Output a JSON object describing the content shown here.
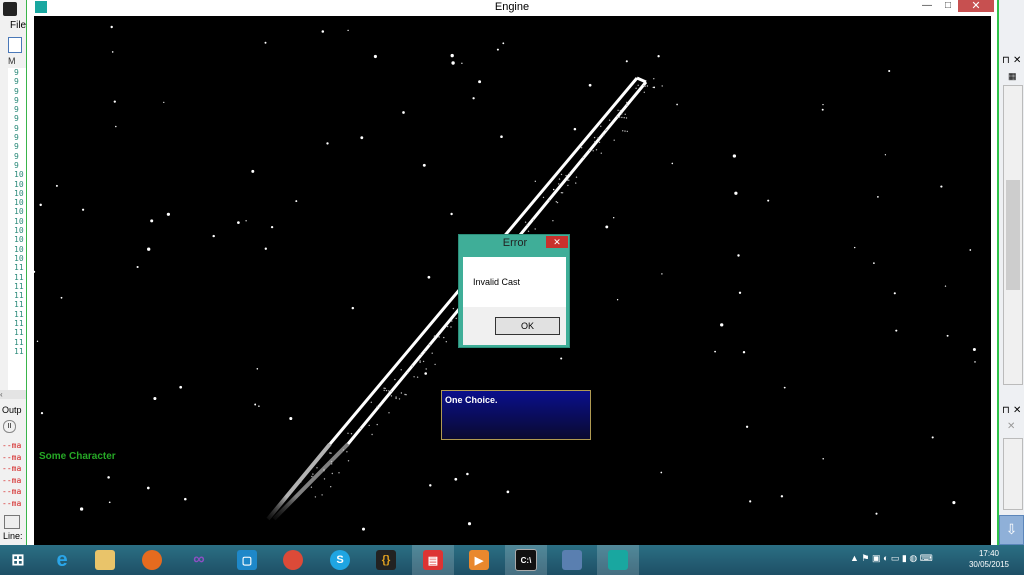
{
  "ide_left": {
    "menu_file": "File",
    "tab_label": "M",
    "line_numbers": [
      "9",
      "9",
      "9",
      "9",
      "9",
      "9",
      "9",
      "9",
      "9",
      "9",
      "9",
      "10",
      "10",
      "10",
      "10",
      "10",
      "10",
      "10",
      "10",
      "10",
      "10",
      "11",
      "11",
      "11",
      "11",
      "11",
      "11",
      "11",
      "11",
      "11",
      "11"
    ],
    "output_label": "Outp",
    "output_lines": [
      "--ma",
      "--ma",
      "--ma",
      "--ma",
      "--ma",
      "--ma"
    ],
    "status_label": "Line:"
  },
  "window": {
    "title": "Engine",
    "minimize": "—",
    "maximize": "□",
    "close": "✕"
  },
  "dialog": {
    "title": "Error",
    "close": "✕",
    "message": "Invalid Cast",
    "ok_label": "OK"
  },
  "game": {
    "choice_text": "One Choice.",
    "character_name": "Some Character"
  },
  "taskbar": {
    "apps": [
      "windows-start-icon",
      "internet-explorer-icon",
      "file-explorer-icon",
      "firefox-icon",
      "visual-studio-icon",
      "app-icon-blue",
      "chrome-icon",
      "skype-icon",
      "code-editor-icon",
      "pdf-reader-icon",
      "media-player-icon",
      "command-prompt-icon",
      "image-editor-icon",
      "engine-app-icon"
    ],
    "clock_time": "17:40",
    "clock_date": "30/05/2015"
  }
}
